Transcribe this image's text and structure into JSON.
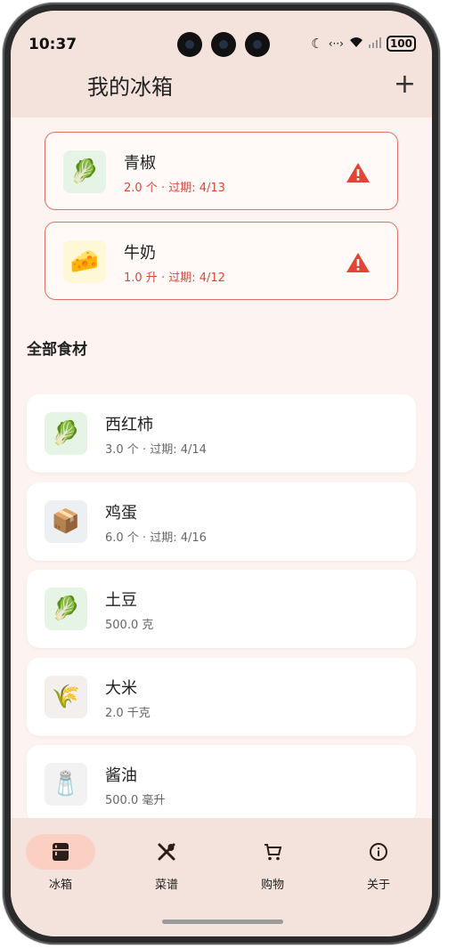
{
  "status_bar": {
    "time": "10:37",
    "battery": "100"
  },
  "app_bar": {
    "title": "我的冰箱",
    "add_label": "+"
  },
  "expiring": [
    {
      "name": "青椒",
      "meta": "2.0 个 · 过期: 4/13",
      "icon": "lettuce-icon"
    },
    {
      "name": "牛奶",
      "meta": "1.0 升 · 过期: 4/12",
      "icon": "cheese-icon"
    }
  ],
  "section_title": "全部食材",
  "items": [
    {
      "name": "西红柿",
      "meta": "3.0 个 · 过期: 4/14",
      "icon": "lettuce-icon"
    },
    {
      "name": "鸡蛋",
      "meta": "6.0 个 · 过期: 4/16",
      "icon": "package-icon"
    },
    {
      "name": "土豆",
      "meta": "500.0 克",
      "icon": "lettuce-icon"
    },
    {
      "name": "大米",
      "meta": "2.0 千克",
      "icon": "rice-icon"
    },
    {
      "name": "酱油",
      "meta": "500.0 毫升",
      "icon": "salt-shaker-icon"
    }
  ],
  "nav": [
    {
      "label": "冰箱",
      "icon": "fridge-icon",
      "active": true
    },
    {
      "label": "菜谱",
      "icon": "utensils-icon",
      "active": false
    },
    {
      "label": "购物",
      "icon": "cart-icon",
      "active": false
    },
    {
      "label": "关于",
      "icon": "info-icon",
      "active": false
    }
  ],
  "colors": {
    "accent": "#fbcfc2",
    "warning": "#e04535",
    "header_bg": "#f4e2dc"
  }
}
